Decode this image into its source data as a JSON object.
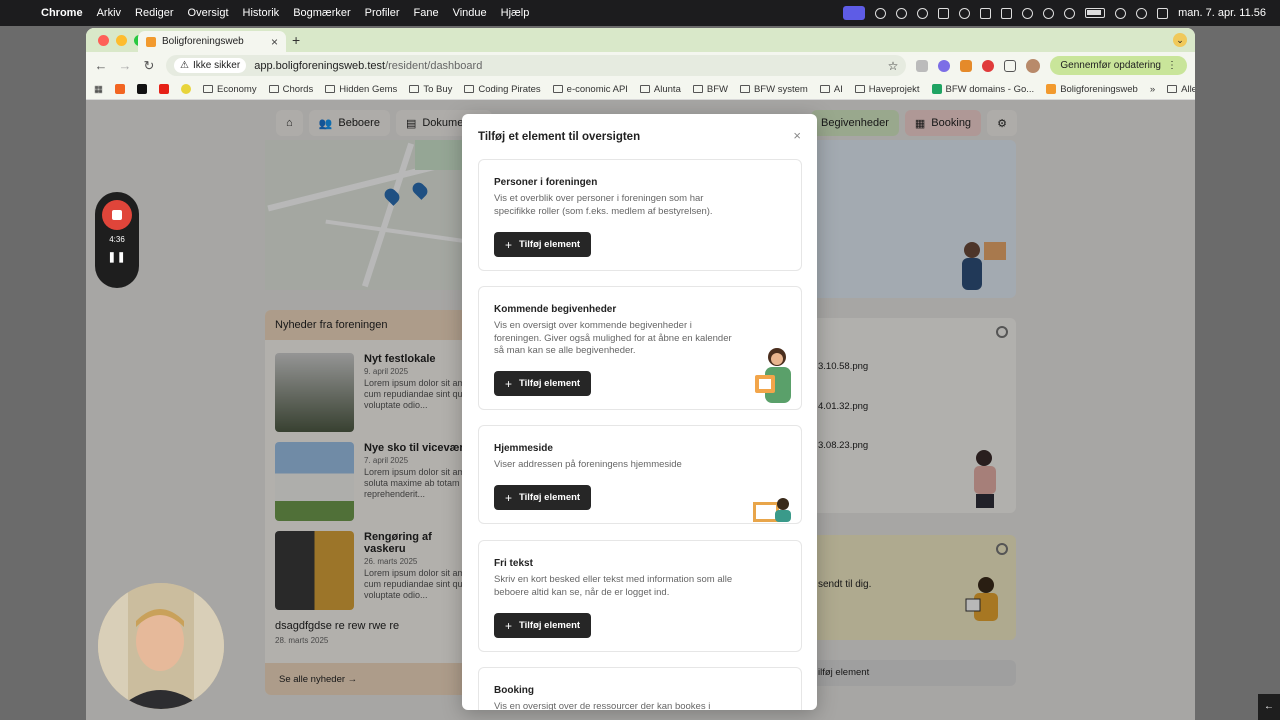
{
  "menubar": {
    "app": "Chrome",
    "items": [
      "Arkiv",
      "Rediger",
      "Oversigt",
      "Historik",
      "Bogmærker",
      "Profiler",
      "Fane",
      "Vindue",
      "Hjælp"
    ],
    "clock": "man. 7. apr.  11.56"
  },
  "browser": {
    "tab_title": "Boligforeningsweb",
    "security_label": "Ikke sikker",
    "url_host": "app.boligforeningsweb.test",
    "url_path": "/resident/dashboard",
    "update_label": "Gennemfør opdatering",
    "bookmarks": [
      "Economy",
      "Chords",
      "Hidden Gems",
      "To Buy",
      "Coding Pirates",
      "e-conomic API",
      "Alunta",
      "BFW",
      "BFW system",
      "AI",
      "Haveprojekt",
      "BFW domains - Go...",
      "Boligforeningsweb"
    ],
    "all_bookmarks": "Alle bogmærker"
  },
  "page": {
    "nav": {
      "beboere": "Beboere",
      "dokumenter": "Dokumenter",
      "begivenheder": "Begivenheder",
      "booking": "Booking"
    },
    "news": {
      "heading": "Nyheder fra foreningen",
      "items": [
        {
          "title": "Nyt festlokale",
          "date": "9. april 2025",
          "text": "Lorem ipsum dolor sit am cum repudiandae sint qu voluptate odio..."
        },
        {
          "title": "Nye sko til viceværte",
          "date": "7. april 2025",
          "text": "Lorem ipsum dolor sit am soluta maxime ab totam reprehenderit..."
        },
        {
          "title": "Rengøring af vaskeru",
          "date": "26. marts 2025",
          "text": "Lorem ipsum dolor sit am cum repudiandae sint qu voluptate odio..."
        },
        {
          "title": "dsagdfgdse re rew rwe re",
          "date": "28. marts 2025"
        }
      ],
      "see_all": "Se alle nyheder →"
    },
    "files": [
      "3.10.58.png",
      "4.01.32.png",
      "3.08.23.png"
    ],
    "sent_text": "sendt til dig.",
    "add_element_partial": "ilføj element"
  },
  "recorder": {
    "time": "4:36"
  },
  "modal": {
    "title": "Tilføj et element til oversigten",
    "add_label": "Tilføj element",
    "options": [
      {
        "title": "Personer i foreningen",
        "desc": "Vis et overblik over personer i foreningen som har specifikke roller (som f.eks. medlem af bestyrelsen)."
      },
      {
        "title": "Kommende begivenheder",
        "desc": "Vis en oversigt over kommende begivenheder i foreningen. Giver også mulighed for at åbne en kalender så man kan se alle begivenheder."
      },
      {
        "title": "Hjemmeside",
        "desc": "Viser addressen på foreningens hjemmeside"
      },
      {
        "title": "Fri tekst",
        "desc": "Skriv en kort besked eller tekst med information som alle beboere altid kan se, når de er logget ind."
      },
      {
        "title": "Booking",
        "desc": "Vis en oversigt over de ressourcer der kan bookes i"
      }
    ]
  },
  "colors": {
    "tab_bar": "#d9e8c9",
    "button_dark": "#262626",
    "news_accent": "#f0d9c0",
    "record_red": "#e0453a"
  }
}
